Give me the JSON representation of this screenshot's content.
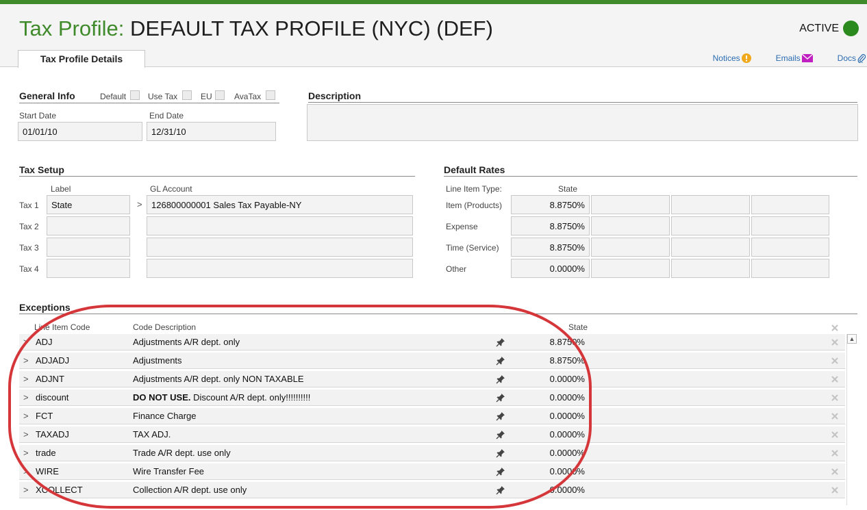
{
  "header": {
    "title_prefix": "Tax Profile:",
    "title_name": "DEFAULT TAX PROFILE (NYC)  (DEF)",
    "status": "ACTIVE",
    "status_color": "#2b8a1e",
    "brand_color": "#3f8a2a"
  },
  "tabs": [
    {
      "label": "Tax Profile Details"
    }
  ],
  "links": {
    "notices": "Notices",
    "emails": "Emails",
    "docs": "Docs"
  },
  "general_info": {
    "title": "General Info",
    "flags": [
      {
        "label": "Default"
      },
      {
        "label": "Use Tax"
      },
      {
        "label": "EU"
      },
      {
        "label": "AvaTax"
      }
    ],
    "start_date_label": "Start Date",
    "start_date": "01/01/10",
    "end_date_label": "End Date",
    "end_date": "12/31/10"
  },
  "description": {
    "title": "Description",
    "value": ""
  },
  "tax_setup": {
    "title": "Tax Setup",
    "label_header": "Label",
    "gl_header": "GL Account",
    "rows": [
      {
        "name": "Tax 1",
        "label": "State",
        "gl": "126800000001 Sales Tax Payable-NY"
      },
      {
        "name": "Tax 2",
        "label": "",
        "gl": ""
      },
      {
        "name": "Tax 3",
        "label": "",
        "gl": ""
      },
      {
        "name": "Tax 4",
        "label": "",
        "gl": ""
      }
    ]
  },
  "default_rates": {
    "title": "Default Rates",
    "type_header": "Line Item Type:",
    "state_header": "State",
    "rows": [
      {
        "type": "Item (Products)",
        "state": "8.8750%"
      },
      {
        "type": "Expense",
        "state": "8.8750%"
      },
      {
        "type": "Time (Service)",
        "state": "8.8750%"
      },
      {
        "type": "Other",
        "state": "0.0000%"
      }
    ]
  },
  "exceptions": {
    "title": "Exceptions",
    "code_header": "Line Item Code",
    "desc_header": "Code Description",
    "state_header": "State",
    "rows": [
      {
        "code": "ADJ",
        "desc_bold": "",
        "desc": "Adjustments A/R dept. only",
        "state": "8.8750%"
      },
      {
        "code": "ADJADJ",
        "desc_bold": "",
        "desc": "Adjustments",
        "state": "8.8750%"
      },
      {
        "code": "ADJNT",
        "desc_bold": "",
        "desc": "Adjustments A/R dept. only NON TAXABLE",
        "state": "0.0000%"
      },
      {
        "code": "discount",
        "desc_bold": "DO NOT USE.",
        "desc": " Discount A/R dept. only!!!!!!!!!!",
        "state": "0.0000%"
      },
      {
        "code": "FCT",
        "desc_bold": "",
        "desc": "Finance Charge",
        "state": "0.0000%"
      },
      {
        "code": "TAXADJ",
        "desc_bold": "",
        "desc": "TAX ADJ.",
        "state": "0.0000%"
      },
      {
        "code": "trade",
        "desc_bold": "",
        "desc": "Trade A/R dept. use only",
        "state": "0.0000%"
      },
      {
        "code": "WIRE",
        "desc_bold": "",
        "desc": "Wire Transfer Fee",
        "state": "0.0000%"
      },
      {
        "code": "XCOLLECT",
        "desc_bold": "",
        "desc": "Collection A/R dept. use only",
        "state": "0.0000%"
      }
    ]
  },
  "icons": {
    "notices": "warning-circle-icon",
    "emails": "envelope-icon",
    "docs": "paperclip-icon",
    "pin": "pin-icon",
    "remove": "close-icon"
  },
  "annotation_color": "#d5363a"
}
